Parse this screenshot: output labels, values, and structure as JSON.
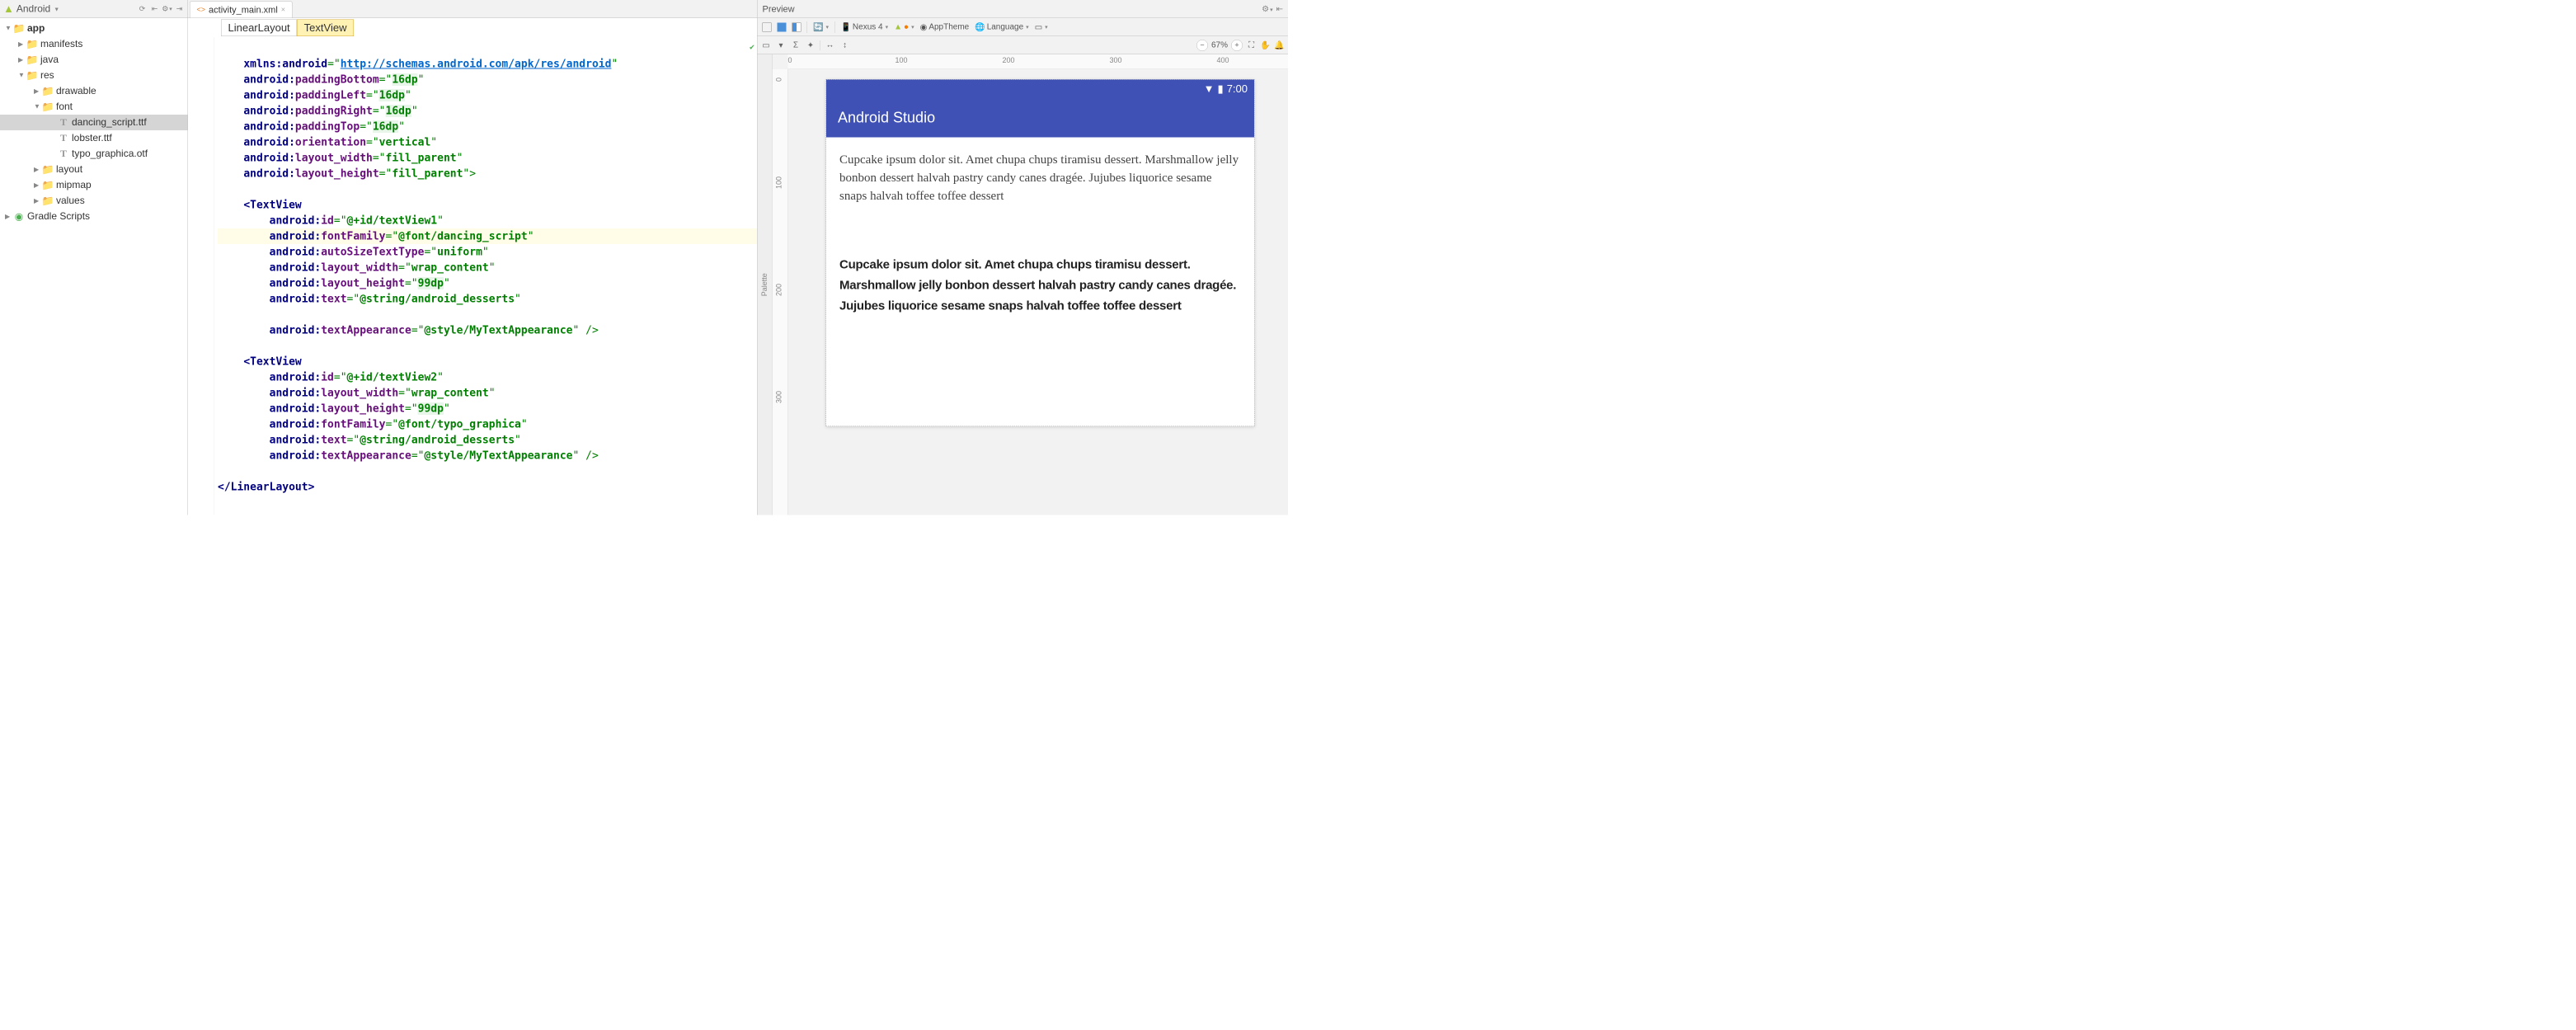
{
  "leftToolbar": {
    "viewMode": "Android"
  },
  "tree": {
    "app": "app",
    "manifests": "manifests",
    "java": "java",
    "res": "res",
    "drawable": "drawable",
    "font": "font",
    "dancing_script": "dancing_script.ttf",
    "lobster": "lobster.ttf",
    "typo_graphica": "typo_graphica.otf",
    "layout": "layout",
    "mipmap": "mipmap",
    "values": "values",
    "gradle": "Gradle Scripts"
  },
  "tab": {
    "filename": "activity_main.xml"
  },
  "breadcrumb": {
    "linear": "LinearLayout",
    "textview": "TextView"
  },
  "code": {
    "l1a": "xmlns:",
    "l1b": "android",
    "l1c": "=\"",
    "l1d": "http://schemas.android.com/apk/res/android",
    "l1e": "\"",
    "l2a": "android:",
    "l2b": "paddingBottom",
    "l2c": "=\"",
    "l2d": "16dp",
    "l2e": "\"",
    "l3a": "android:",
    "l3b": "paddingLeft",
    "l3c": "=\"",
    "l3d": "16dp",
    "l3e": "\"",
    "l4a": "android:",
    "l4b": "paddingRight",
    "l4c": "=\"",
    "l4d": "16dp",
    "l4e": "\"",
    "l5a": "android:",
    "l5b": "paddingTop",
    "l5c": "=\"",
    "l5d": "16dp",
    "l5e": "\"",
    "l6a": "android:",
    "l6b": "orientation",
    "l6c": "=\"",
    "l6d": "vertical",
    "l6e": "\"",
    "l7a": "android:",
    "l7b": "layout_width",
    "l7c": "=\"",
    "l7d": "fill_parent",
    "l7e": "\"",
    "l8a": "android:",
    "l8b": "layout_height",
    "l8c": "=\"",
    "l8d": "fill_parent",
    "l8e": "\">",
    "l10": "<",
    "l10t": "TextView",
    "l11a": "android:",
    "l11b": "id",
    "l11c": "=\"",
    "l11d": "@+id/textView1",
    "l11e": "\"",
    "l12a": "android:",
    "l12b": "fontFamily",
    "l12c": "=\"",
    "l12d": "@font/dancing_script",
    "l12e": "\"",
    "l13a": "android:",
    "l13b": "autoSizeTextType",
    "l13c": "=\"",
    "l13d": "uniform",
    "l13e": "\"",
    "l14a": "android:",
    "l14b": "layout_width",
    "l14c": "=\"",
    "l14d": "wrap_content",
    "l14e": "\"",
    "l15a": "android:",
    "l15b": "layout_height",
    "l15c": "=\"",
    "l15d": "99dp",
    "l15e": "\"",
    "l16a": "android:",
    "l16b": "text",
    "l16c": "=\"",
    "l16d": "@string/android_desserts",
    "l16e": "\"",
    "l18a": "android:",
    "l18b": "textAppearance",
    "l18c": "=\"",
    "l18d": "@style/MyTextAppearance",
    "l18e": "\" />",
    "l20": "<",
    "l20t": "TextView",
    "l21a": "android:",
    "l21b": "id",
    "l21c": "=\"",
    "l21d": "@+id/textView2",
    "l21e": "\"",
    "l22a": "android:",
    "l22b": "layout_width",
    "l22c": "=\"",
    "l22d": "wrap_content",
    "l22e": "\"",
    "l23a": "android:",
    "l23b": "layout_height",
    "l23c": "=\"",
    "l23d": "99dp",
    "l23e": "\"",
    "l24a": "android:",
    "l24b": "fontFamily",
    "l24c": "=\"",
    "l24d": "@font/typo_graphica",
    "l24e": "\"",
    "l25a": "android:",
    "l25b": "text",
    "l25c": "=\"",
    "l25d": "@string/android_desserts",
    "l25e": "\"",
    "l26a": "android:",
    "l26b": "textAppearance",
    "l26c": "=\"",
    "l26d": "@style/MyTextAppearance",
    "l26e": "\" />",
    "l28a": "</",
    "l28b": "LinearLayout",
    "l28c": ">"
  },
  "preview": {
    "title": "Preview",
    "palette": "Palette",
    "device": "Nexus 4",
    "theme": "AppTheme",
    "language": "Language",
    "zoom": "67%",
    "ruler": {
      "r0": "0",
      "r100": "100",
      "r200": "200",
      "r300": "300",
      "r400": "400"
    },
    "rulerV": {
      "v0": "0",
      "v100": "100",
      "v200": "200",
      "v300": "300"
    },
    "statusTime": "7:00",
    "appTitle": "Android Studio",
    "text1": "Cupcake ipsum dolor sit. Amet chupa chups tiramisu dessert. Marshmallow jelly bonbon dessert halvah pastry candy canes dragée. Jujubes liquorice sesame snaps halvah toffee toffee dessert",
    "text2": "Cupcake ipsum dolor sit. Amet chupa chups tiramisu dessert. Marshmallow jelly bonbon dessert halvah pastry candy canes dragée. Jujubes liquorice sesame snaps halvah toffee toffee dessert"
  }
}
